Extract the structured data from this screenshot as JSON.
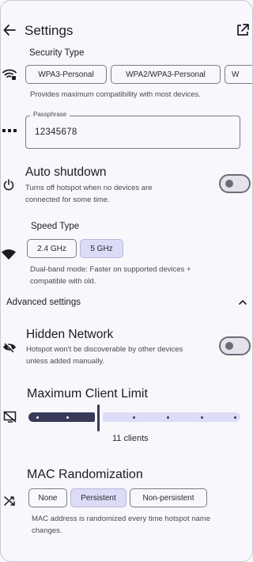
{
  "header": {
    "title": "Settings",
    "back_icon": "arrow-back-icon",
    "open_icon": "open-in-new-icon"
  },
  "security": {
    "label": "Security Type",
    "icon": "wifi-lock-icon",
    "options": [
      "WPA3-Personal",
      "WPA2/WPA3-Personal",
      "W"
    ],
    "description": "Provides maximum compatibility with most devices."
  },
  "passphrase": {
    "icon": "password-dots-icon",
    "label": "Passphrase",
    "value": "12345678"
  },
  "auto_shutdown": {
    "icon": "power-icon",
    "title": "Auto shutdown",
    "description_line1": "Turns off hotspot when no devices are",
    "description_line2": "connected for some time.",
    "enabled": false
  },
  "speed": {
    "icon": "wifi-icon",
    "label": "Speed Type",
    "options": [
      "2.4 GHz",
      "5 GHz"
    ],
    "selected": "5 GHz",
    "description_line1": "Dual-band mode: Faster on supported devices +",
    "description_line2": "compatible with old."
  },
  "advanced": {
    "label": "Advanced settings",
    "icon": "chevron-up-icon"
  },
  "hidden_network": {
    "icon": "eye-off-icon",
    "title": "Hidden Network",
    "description_line1": "Hotspot won't be discoverable by other devices",
    "description_line2": "unless added manually.",
    "enabled": false
  },
  "client_limit": {
    "icon": "device-off-icon",
    "title": "Maximum Client Limit",
    "value_label": "11 clients",
    "value": 11
  },
  "mac": {
    "icon": "shuffle-icon",
    "title": "MAC Randomization",
    "options": [
      "None",
      "Persistent",
      "Non-persistent"
    ],
    "selected": "Persistent",
    "description_line1": "MAC address is randomized every time hotspot name",
    "description_line2": "changes."
  },
  "colors": {
    "background": "#f8f7fc",
    "selected_chip": "#dcdcf6",
    "slider_active": "#393a58",
    "outline": "#7d7b86"
  }
}
